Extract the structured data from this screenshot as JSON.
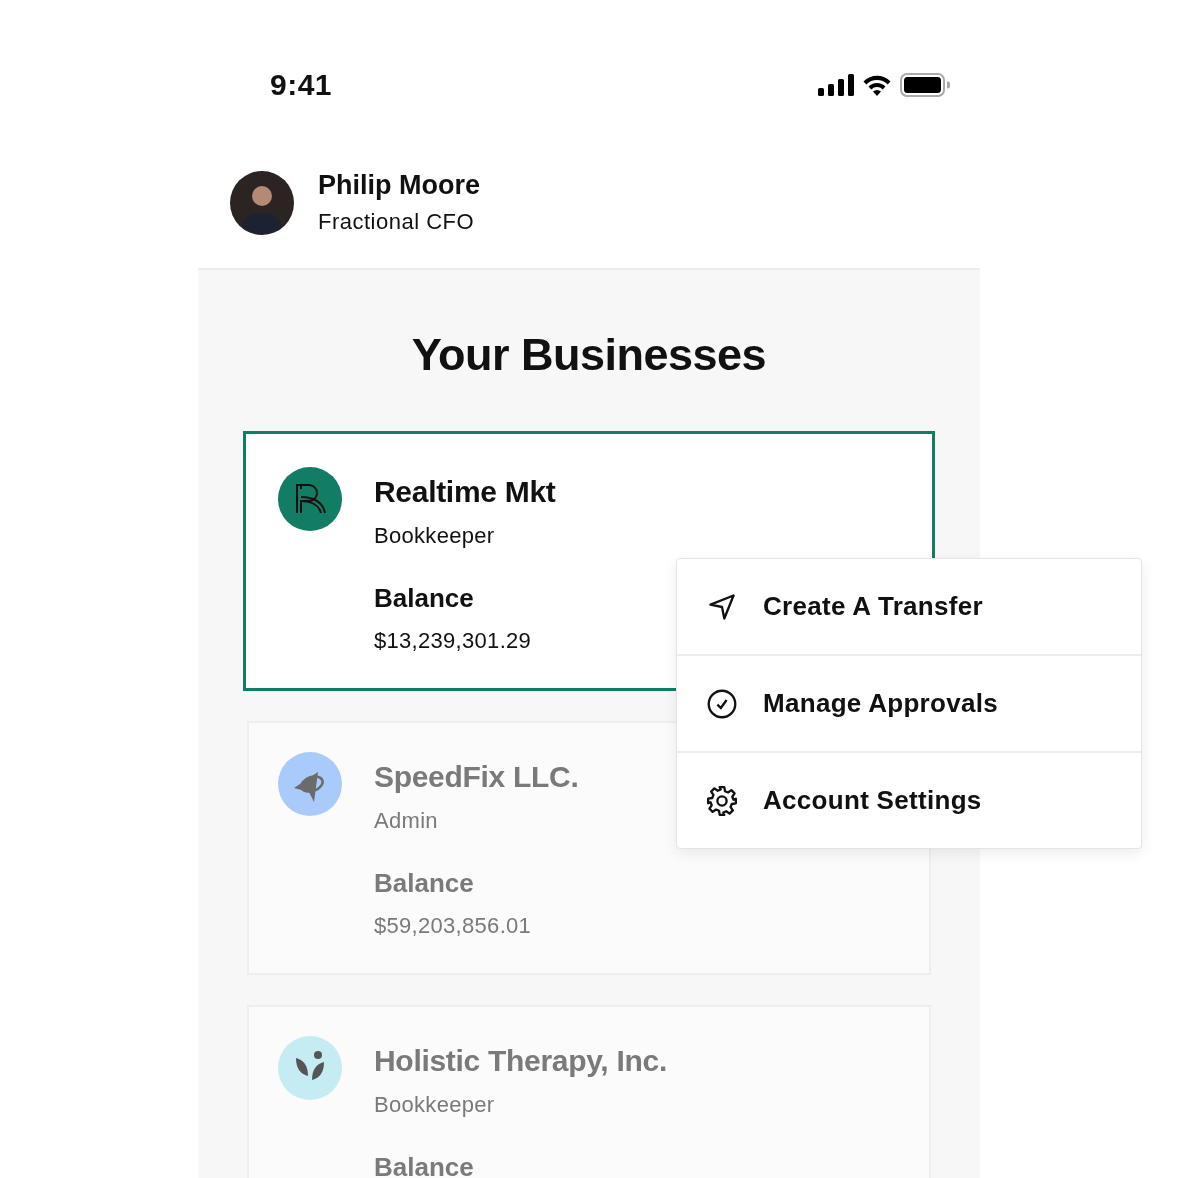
{
  "status_bar": {
    "time": "9:41"
  },
  "profile": {
    "name": "Philip Moore",
    "role": "Fractional CFO"
  },
  "title": "Your Businesses",
  "businesses": [
    {
      "name": "Realtime Mkt",
      "role": "Bookkeeper",
      "balance_label": "Balance",
      "amount": "$13,239,301.29",
      "selected": true,
      "kind": "monogram",
      "color": "#137c64"
    },
    {
      "name": "SpeedFix LLC.",
      "role": "Admin",
      "balance_label": "Balance",
      "amount": "$59,203,856.01",
      "selected": false,
      "kind": "plane",
      "color": "#a8cbfb"
    },
    {
      "name": "Holistic Therapy, Inc.",
      "role": "Bookkeeper",
      "balance_label": "Balance",
      "selected": false,
      "kind": "leaf",
      "color": "#c5ebf3"
    }
  ],
  "menu": [
    {
      "label": "Create A Transfer",
      "kind": "send"
    },
    {
      "label": "Manage Approvals",
      "kind": "check"
    },
    {
      "label": "Account Settings",
      "kind": "gear"
    }
  ]
}
